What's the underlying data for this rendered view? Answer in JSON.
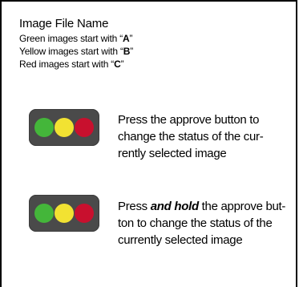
{
  "header": {
    "title": "Image File Name",
    "rules": [
      {
        "prefix": "Green images start with “",
        "letter": "A",
        "suffix": "”"
      },
      {
        "prefix": "Yellow images start with “",
        "letter": "B",
        "suffix": "”"
      },
      {
        "prefix": "Red images start with “",
        "letter": "C",
        "suffix": "”"
      }
    ]
  },
  "colors": {
    "green": "#44b63a",
    "yellow": "#f2e232",
    "red": "#c8102e",
    "button_body": "#4a4a4a"
  },
  "press": {
    "lines": [
      "Press the approve button to",
      "change the status of the cur-",
      "rently selected image"
    ]
  },
  "press_hold": {
    "line1_before": "Press ",
    "line1_emphasis": "and hold",
    "line1_after": " the approve but-",
    "line2": "ton to change the status of the",
    "line3": "currently selected image"
  }
}
